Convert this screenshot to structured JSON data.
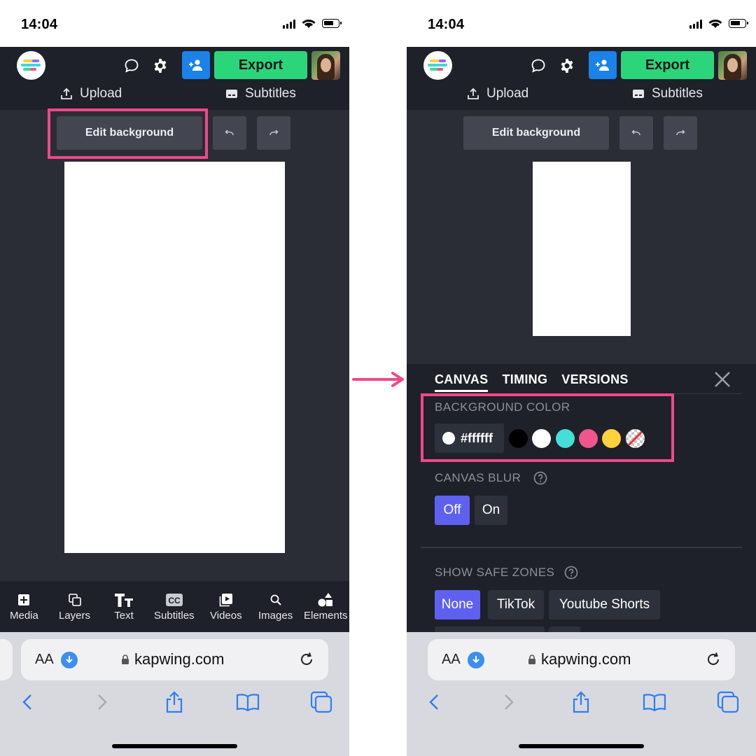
{
  "status_time": "14:04",
  "app": {
    "export_label": "Export",
    "upload_label": "Upload",
    "subtitles_label": "Subtitles",
    "edit_background_label": "Edit background"
  },
  "toolbar": [
    {
      "label": "Media",
      "icon": "media-icon"
    },
    {
      "label": "Layers",
      "icon": "layers-icon"
    },
    {
      "label": "Text",
      "icon": "text-icon"
    },
    {
      "label": "Subtitles",
      "icon": "cc-icon"
    },
    {
      "label": "Videos",
      "icon": "video-icon"
    },
    {
      "label": "Images",
      "icon": "search-icon"
    },
    {
      "label": "Elements",
      "icon": "shapes-icon"
    }
  ],
  "panel": {
    "tabs": [
      "CANVAS",
      "TIMING",
      "VERSIONS"
    ],
    "active_tab": "CANVAS",
    "background_color_label": "BACKGROUND COLOR",
    "hex_value": "#ffffff",
    "swatches": [
      "#000000",
      "#ffffff",
      "#45dfd7",
      "#f0568c",
      "#ffd23d",
      "transparent"
    ],
    "canvas_blur_label": "CANVAS BLUR",
    "blur_options": [
      "Off",
      "On"
    ],
    "blur_selected": "Off",
    "safe_zones_label": "SHOW SAFE ZONES",
    "safe_zone_options": [
      "None",
      "TikTok",
      "Youtube Shorts"
    ],
    "safe_zone_selected": "None"
  },
  "safari": {
    "aa_label": "AA",
    "url": "kapwing.com"
  },
  "colors": {
    "accent_export": "#2bd67b",
    "accent_share": "#1a82e8",
    "highlight": "#f0488a",
    "selected_segment": "#5e61f0"
  }
}
